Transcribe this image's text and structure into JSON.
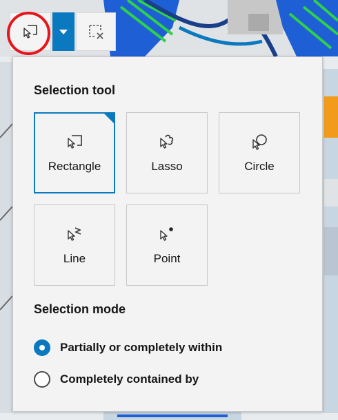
{
  "panel": {
    "selection_tool_title": "Selection tool",
    "tools": [
      {
        "label": "Rectangle",
        "icon": "rectangle-select-icon",
        "selected": true
      },
      {
        "label": "Lasso",
        "icon": "lasso-select-icon",
        "selected": false
      },
      {
        "label": "Circle",
        "icon": "circle-select-icon",
        "selected": false
      },
      {
        "label": "Line",
        "icon": "line-select-icon",
        "selected": false
      },
      {
        "label": "Point",
        "icon": "point-select-icon",
        "selected": false
      }
    ],
    "selection_mode_title": "Selection mode",
    "modes": [
      {
        "label": "Partially or completely within",
        "checked": true
      },
      {
        "label": "Completely contained by",
        "checked": false
      }
    ]
  },
  "colors": {
    "accent": "#0a79bf",
    "highlight": "#e8141b",
    "panel_bg": "#f3f3f3"
  }
}
